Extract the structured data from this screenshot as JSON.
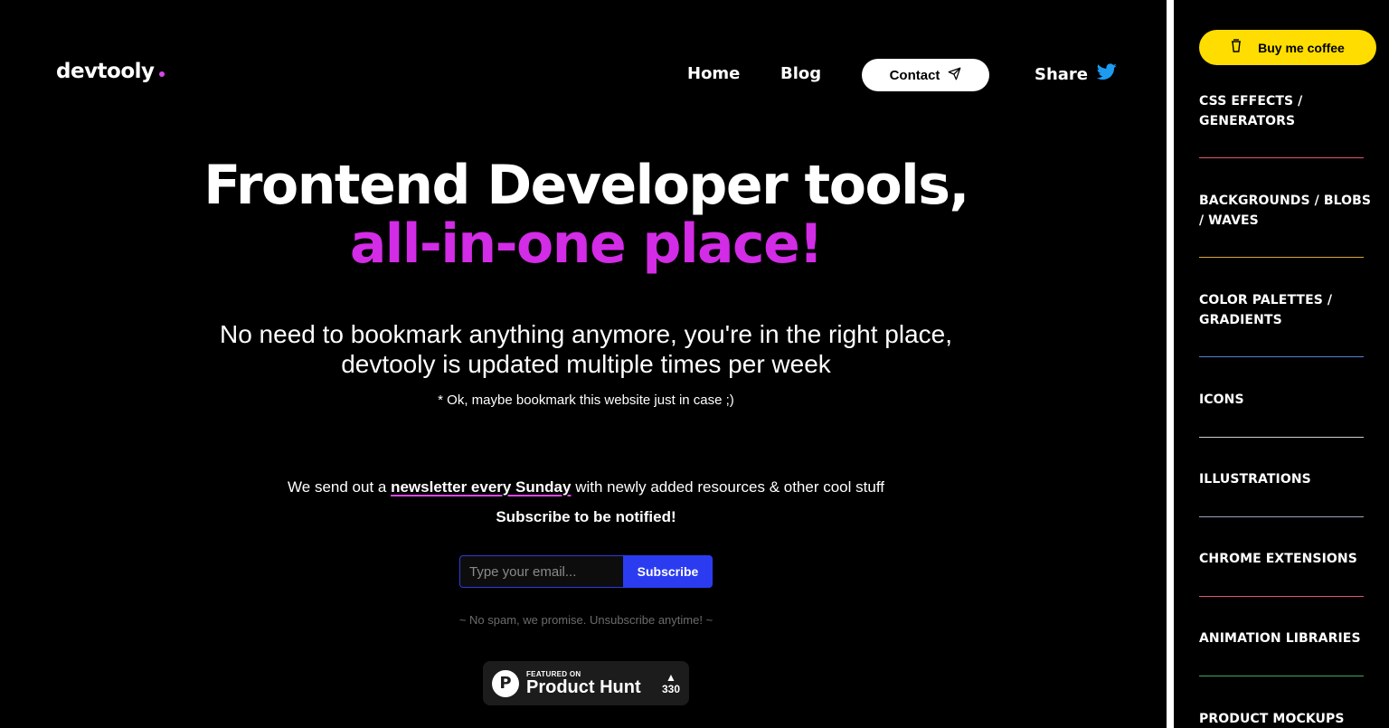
{
  "header": {
    "logo": "devtooly",
    "nav": {
      "home": "Home",
      "blog": "Blog",
      "contact": "Contact",
      "share": "Share"
    }
  },
  "hero": {
    "title_line1": "Frontend Developer tools,",
    "title_line2": "all-in-one place!",
    "subtitle_line1": "No need to bookmark anything anymore, you're in the right place,",
    "subtitle_line2": "devtooly is updated multiple times per week",
    "note": "* Ok, maybe bookmark this website just in case ;)"
  },
  "newsletter": {
    "text_before": "We send out a ",
    "highlight": "newsletter every Sunday",
    "text_after": " with newly added resources & other cool stuff",
    "cta": "Subscribe to be notified!",
    "email_placeholder": "Type your email...",
    "button": "Subscribe",
    "disclaimer": "~ No spam, we promise. Unsubscribe anytime! ~"
  },
  "product_hunt": {
    "small": "FEATURED ON",
    "big": "Product Hunt",
    "votes": "330"
  },
  "sidebar": {
    "coffee_button": "Buy me coffee",
    "categories": [
      {
        "label": "CSS EFFECTS / GENERATORS",
        "color": "#e0566e"
      },
      {
        "label": "BACKGROUNDS / BLOBS / WAVES",
        "color": "#d9a73b"
      },
      {
        "label": "COLOR PALETTES / GRADIENTS",
        "color": "#5a7fd6"
      },
      {
        "label": "ICONS",
        "color": "#cfcfcf"
      },
      {
        "label": "ILLUSTRATIONS",
        "color": "#9aa5b8"
      },
      {
        "label": "CHROME EXTENSIONS",
        "color": "#e0566e"
      },
      {
        "label": "ANIMATION LIBRARIES",
        "color": "#3fa85e"
      },
      {
        "label": "PRODUCT MOCKUPS",
        "color": "#cfcfcf"
      }
    ]
  },
  "colors": {
    "accent": "#d22ce6",
    "subscribe_blue": "#2b3cf0",
    "coffee_yellow": "#ffdd00"
  }
}
